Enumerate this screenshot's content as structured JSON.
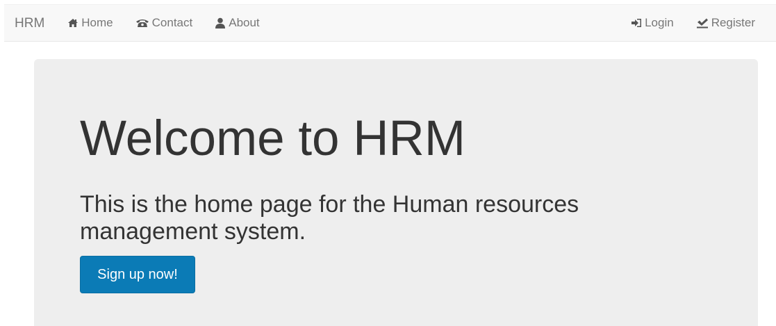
{
  "navbar": {
    "brand": "HRM",
    "left_items": [
      {
        "label": "Home",
        "icon": "home-icon"
      },
      {
        "label": "Contact",
        "icon": "phone-icon"
      },
      {
        "label": "About",
        "icon": "user-icon"
      }
    ],
    "right_items": [
      {
        "label": "Login",
        "icon": "login-icon"
      },
      {
        "label": "Register",
        "icon": "register-icon"
      }
    ]
  },
  "hero": {
    "title": "Welcome to HRM",
    "lead": "This is the home page for the Human resources management system.",
    "cta_label": "Sign up now!"
  },
  "colors": {
    "navbar_bg": "#f8f8f8",
    "nav_text": "#777777",
    "jumbotron_bg": "#eeeeee",
    "primary": "#0b7bb6"
  }
}
